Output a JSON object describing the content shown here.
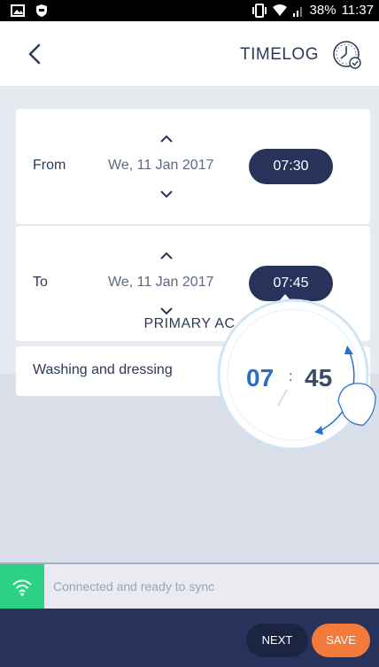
{
  "status_bar": {
    "battery": "38%",
    "time": "11:37"
  },
  "header": {
    "title": "TIMELOG"
  },
  "from": {
    "label": "From",
    "date": "We, 11 Jan 2017",
    "time": "07:30"
  },
  "to": {
    "label": "To",
    "date": "We, 11 Jan 2017",
    "time": "07:45"
  },
  "time_picker": {
    "hour": "07",
    "separator": ":",
    "minute": "45"
  },
  "primary_activity": {
    "title": "PRIMARY AC",
    "value": "Washing and dressing"
  },
  "sync": {
    "text": "Connected and ready to sync"
  },
  "footer": {
    "next_label": "NEXT",
    "save_label": "SAVE"
  },
  "colors": {
    "navy": "#27335a",
    "accent_orange": "#f47a3c",
    "sync_green": "#2bd184",
    "picker_blue": "#2470c9"
  }
}
